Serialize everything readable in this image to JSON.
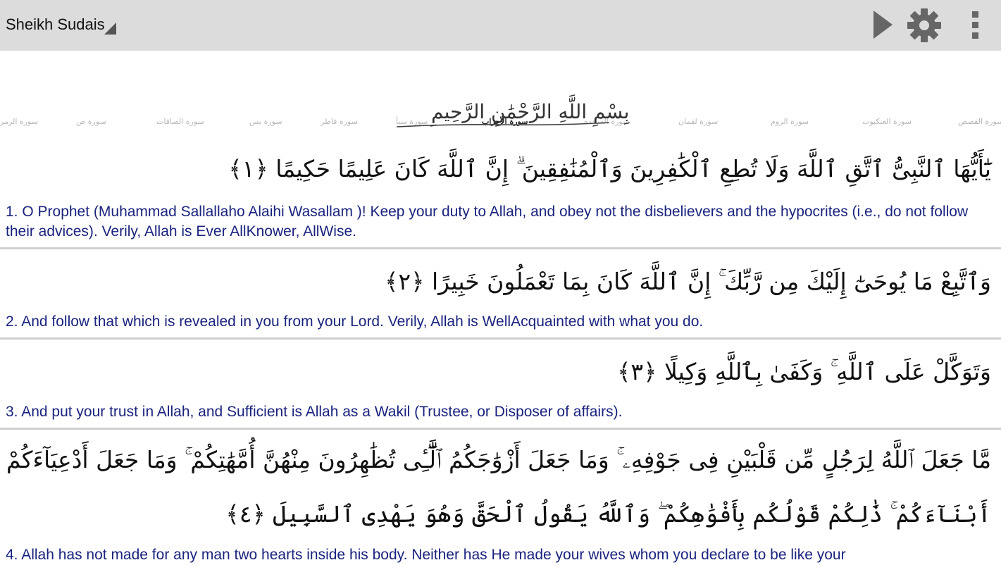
{
  "header": {
    "reciter": "Sheikh Sudais",
    "icons": {
      "play": "play-icon",
      "settings": "gear-icon",
      "menu": "overflow-menu-icon"
    }
  },
  "surah_strip": [
    "سورة الزمر",
    "سورة ص",
    "سورة الصافات",
    "سورة يس",
    "سورة فاطر",
    "سورة سبأ",
    "سورة الأحزاب",
    "سورة السجدة",
    "سورة لقمان",
    "سورة الروم",
    "سورة العنكبوت",
    "سورة القصص"
  ],
  "bismillah": "بِسْمِ اللَّهِ الرَّحْمَٰنِ الرَّحِيمِ",
  "verses": [
    {
      "arabic": "يَٰٓأَيُّهَا ٱلنَّبِىُّ ٱتَّقِ ٱللَّهَ وَلَا تُطِعِ ٱلْكَٰفِرِينَ وَٱلْمُنَٰفِقِينَ ۗ إِنَّ ٱللَّهَ كَانَ عَلِيمًا حَكِيمًا ﴿١﴾",
      "translation": "1. O Prophet (Muhammad  Sallallaho Alaihi Wasallam )! Keep your duty to Allah, and obey not the disbelievers and the hypocrites (i.e., do not follow their advices). Verily, Allah is Ever AllKnower, AllWise."
    },
    {
      "arabic": "وَٱتَّبِعْ مَا يُوحَىٰٓ إِلَيْكَ مِن رَّبِّكَ ۚ إِنَّ ٱللَّهَ كَانَ بِمَا تَعْمَلُونَ خَبِيرًا ﴿٢﴾",
      "translation": "2. And follow that which is revealed in you from your Lord. Verily, Allah is WellAcquainted with what you do."
    },
    {
      "arabic": "وَتَوَكَّلْ عَلَى ٱللَّهِ ۚ وَكَفَىٰ بِٱللَّهِ وَكِيلًا ﴿٣﴾",
      "translation": "3. And put your trust in Allah, and Sufficient is Allah as a Wakil (Trustee, or Disposer of affairs)."
    },
    {
      "arabic_line1": "مَّا جَعَلَ ٱللَّهُ لِرَجُلٍ مِّن قَلْبَيْنِ فِى جَوْفِهِۦ ۚ وَمَا جَعَلَ أَزْوَٰجَكُمُ ٱلَّٰٓـِٔى تُظَٰهِرُونَ مِنْهُنَّ أُمَّهَٰتِكُمْ ۚ وَمَا جَعَلَ أَدْعِيَآءَكُمْ",
      "arabic_line2": "أَبْنَآءَكُمْ ۚ ذَٰلِكُمْ قَوْلُكُم بِأَفْوَٰهِكُمْ ۖ وَٱللَّهُ يَقُولُ ٱلْحَقَّ وَهُوَ يَهْدِى ٱلسَّبِيلَ ﴿٤﴾",
      "translation": "4. Allah has not made for any man two hearts inside his body. Neither has He made your wives whom you declare to be like your"
    }
  ]
}
